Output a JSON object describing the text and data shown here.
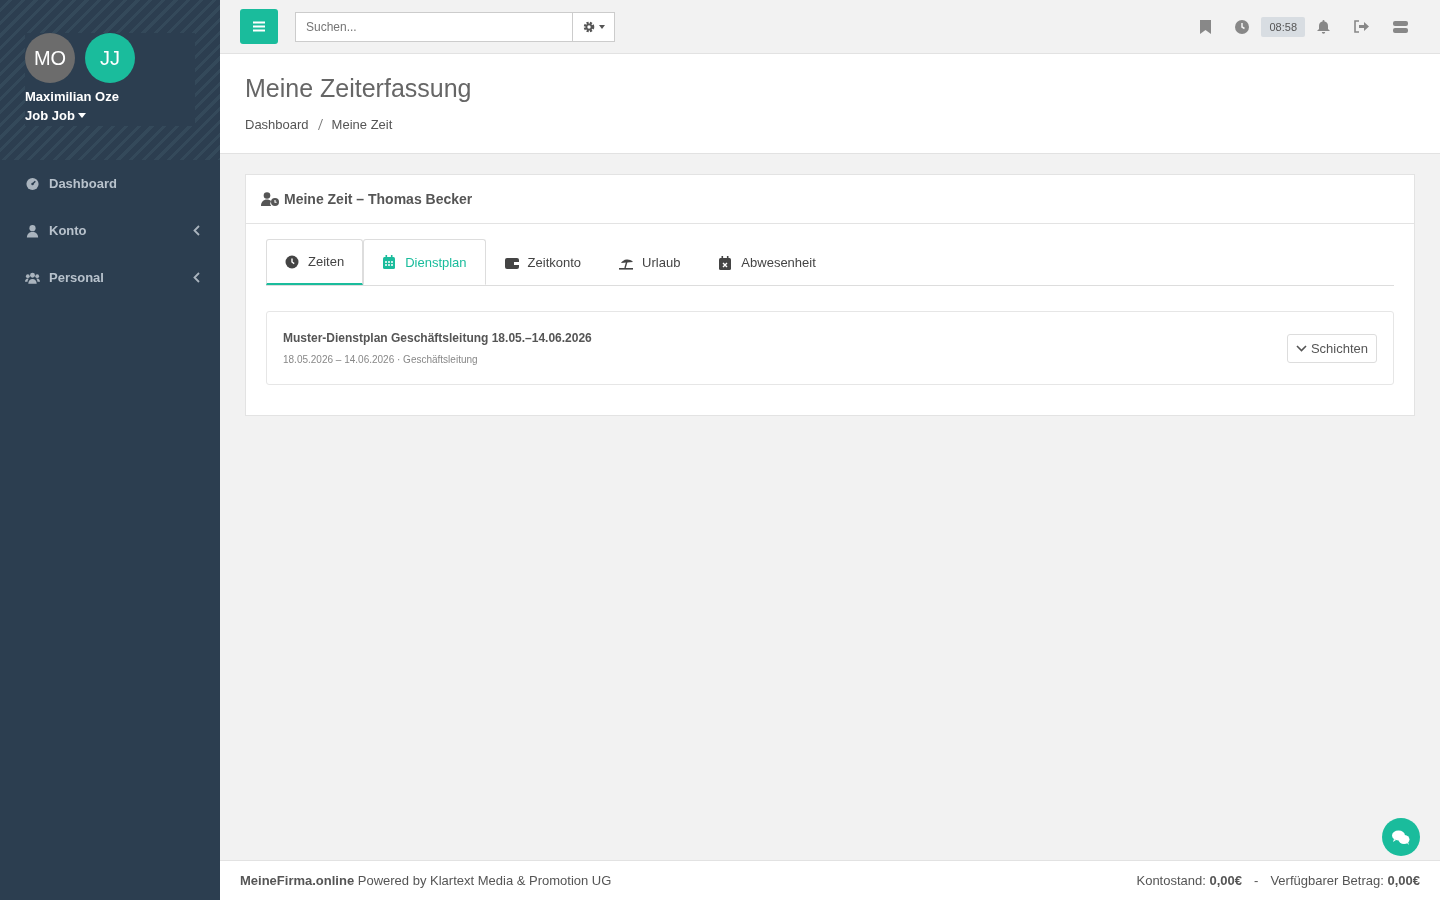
{
  "sidebar": {
    "avatars": [
      {
        "initials": "MO",
        "color": "#6c6c6c"
      },
      {
        "initials": "JJ",
        "color": "#1abc9c"
      }
    ],
    "user_name": "Maximilian Oze",
    "job": "Job Job",
    "items": [
      {
        "label": "Dashboard",
        "has_submenu": false
      },
      {
        "label": "Konto",
        "has_submenu": true
      },
      {
        "label": "Personal",
        "has_submenu": true
      }
    ]
  },
  "topbar": {
    "search": {
      "placeholder": "Suchen..."
    },
    "time": "08:58"
  },
  "page": {
    "title": "Meine Zeiterfassung",
    "breadcrumb": [
      "Dashboard",
      "Meine Zeit"
    ]
  },
  "card": {
    "title": "Meine Zeit – Thomas Becker",
    "tabs": [
      {
        "label": "Zeiten",
        "selected": false,
        "focused": true
      },
      {
        "label": "Dienstplan",
        "selected": true,
        "focused": false
      },
      {
        "label": "Zeitkonto",
        "selected": false,
        "focused": false
      },
      {
        "label": "Urlaub",
        "selected": false,
        "focused": false
      },
      {
        "label": "Abwesenheit",
        "selected": false,
        "focused": false
      }
    ],
    "plans": [
      {
        "title": "Muster-Dienstplan Geschäftsleitung 18.05.–14.06.2026",
        "subtitle": "18.05.2026 – 14.06.2026 · Geschäftsleitung",
        "button": "Schichten"
      }
    ]
  },
  "footer": {
    "brand": "**MeineFirma.online** Powered by Klartext Media & Promotion UG",
    "balance": "Kontostand: **0,00€**",
    "separator": "-",
    "available": "Verfügbarer Betrag: **0,00€**"
  }
}
